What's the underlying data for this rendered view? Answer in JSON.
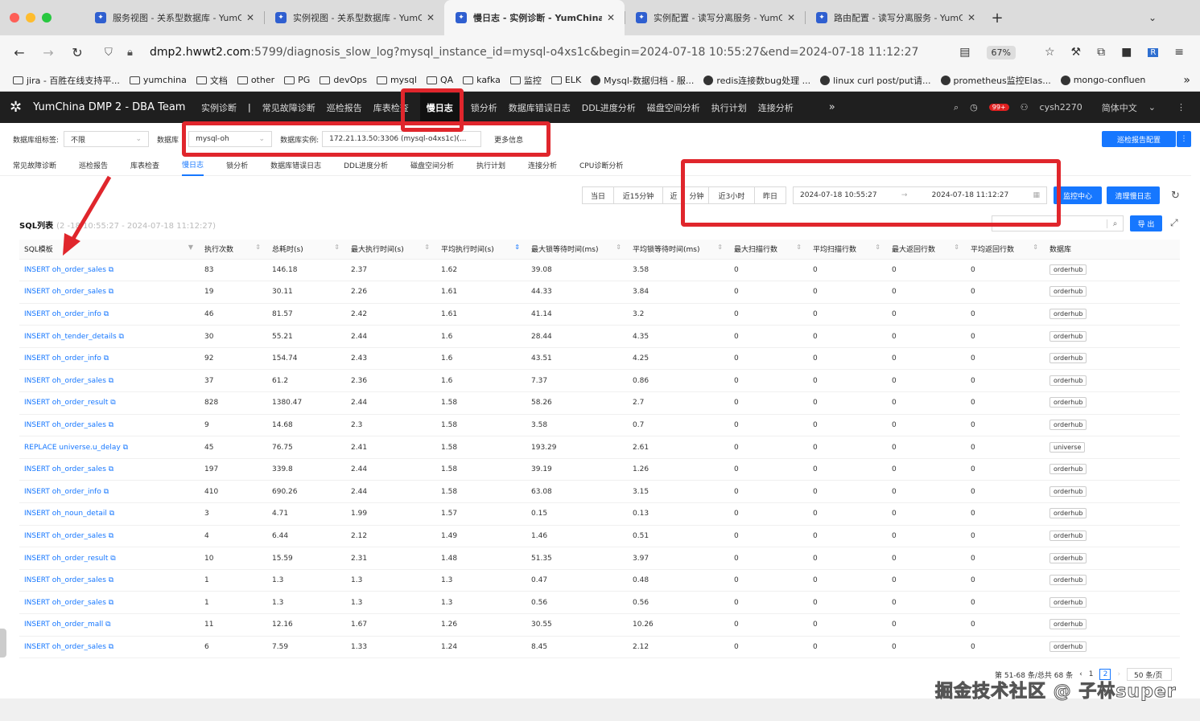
{
  "browser": {
    "tabs": [
      {
        "label": "服务视图 - 关系型数据库 - YumC",
        "active": false
      },
      {
        "label": "实例视图 - 关系型数据库 - YumC",
        "active": false
      },
      {
        "label": "慢日志 - 实例诊断 - YumChina D",
        "active": true
      },
      {
        "label": "实例配置 - 读写分离服务 - YumC",
        "active": false
      },
      {
        "label": "路由配置 - 读写分离服务 - YumC",
        "active": false
      }
    ],
    "url_host": "dmp2.hwwt2.com",
    "url_rest": ":5799/diagnosis_slow_log?mysql_instance_id=mysql-o4xs1c&begin=2024-07-18 10:55:27&end=2024-07-18 11:12:27",
    "zoom": "67%",
    "bookmarks": [
      "jira - 百胜在线支持平...",
      "yumchina",
      "文档",
      "other",
      "PG",
      "devOps",
      "mysql",
      "QA",
      "kafka",
      "监控",
      "ELK",
      "Mysql-数据归档 - 服...",
      "redis连接数bug处理 ...",
      "linux curl post/put请...",
      "prometheus监控Elas...",
      "mongo-confluen"
    ]
  },
  "app": {
    "brand": "YumChina DMP 2 - DBA Team",
    "nav": [
      "实例诊断",
      "常见故障诊断",
      "巡检报告",
      "库表检查",
      "慢日志",
      "锁分析",
      "数据库错误日志",
      "DDL进度分析",
      "磁盘空间分析",
      "执行计划",
      "连接分析"
    ],
    "nav_active": "慢日志",
    "notif_count": "99+",
    "user": "cysh2270",
    "language": "简体中文"
  },
  "filters": {
    "group_label": "数据库组标签:",
    "group_value": "不限",
    "db_label": "数据库",
    "db_value": "mysql-oh",
    "instance_label": "数据库实例:",
    "instance_value": "172.21.13.50:3306 (mysql-o4xs1c)(...",
    "more": "更多信息",
    "report_btn": "巡检报告配置"
  },
  "subtabs": [
    "常见故障诊断",
    "巡检报告",
    "库表检查",
    "慢日志",
    "锁分析",
    "数据库错误日志",
    "DDL进度分析",
    "磁盘空间分析",
    "执行计划",
    "连接分析",
    "CPU诊断分析"
  ],
  "subtab_active": "慢日志",
  "time": {
    "quick": [
      "当日",
      "近15分钟",
      "近",
      "分钟",
      "近3小时",
      "昨日"
    ],
    "start": "2024-07-18 10:55:27",
    "end": "2024-07-18 11:12:27",
    "monitor_btn": "监控中心",
    "clear_btn": "清理慢日志"
  },
  "sql_list": {
    "title": "SQL列表",
    "subtitle": "(2   -18 10:55:27 - 2024-07-18 11:12:27)",
    "export_btn": "导 出",
    "columns": [
      "SQL模板",
      "执行次数",
      "总耗时(s)",
      "最大执行时间(s)",
      "平均执行时间(s)",
      "最大锁等待时间(ms)",
      "平均锁等待时间(ms)",
      "最大扫描行数",
      "平均扫描行数",
      "最大返回行数",
      "平均返回行数",
      "数据库"
    ],
    "rows": [
      [
        "INSERT oh_order_sales",
        "83",
        "146.18",
        "2.37",
        "1.62",
        "39.08",
        "3.58",
        "0",
        "0",
        "0",
        "0",
        "orderhub"
      ],
      [
        "INSERT oh_order_sales",
        "19",
        "30.11",
        "2.26",
        "1.61",
        "44.33",
        "3.84",
        "0",
        "0",
        "0",
        "0",
        "orderhub"
      ],
      [
        "INSERT oh_order_info",
        "46",
        "81.57",
        "2.42",
        "1.61",
        "41.14",
        "3.2",
        "0",
        "0",
        "0",
        "0",
        "orderhub"
      ],
      [
        "INSERT oh_tender_details",
        "30",
        "55.21",
        "2.44",
        "1.6",
        "28.44",
        "4.35",
        "0",
        "0",
        "0",
        "0",
        "orderhub"
      ],
      [
        "INSERT oh_order_info",
        "92",
        "154.74",
        "2.43",
        "1.6",
        "43.51",
        "4.25",
        "0",
        "0",
        "0",
        "0",
        "orderhub"
      ],
      [
        "INSERT oh_order_sales",
        "37",
        "61.2",
        "2.36",
        "1.6",
        "7.37",
        "0.86",
        "0",
        "0",
        "0",
        "0",
        "orderhub"
      ],
      [
        "INSERT oh_order_result",
        "828",
        "1380.47",
        "2.44",
        "1.58",
        "58.26",
        "2.7",
        "0",
        "0",
        "0",
        "0",
        "orderhub"
      ],
      [
        "INSERT oh_order_sales",
        "9",
        "14.68",
        "2.3",
        "1.58",
        "3.58",
        "0.7",
        "0",
        "0",
        "0",
        "0",
        "orderhub"
      ],
      [
        "REPLACE universe.u_delay",
        "45",
        "76.75",
        "2.41",
        "1.58",
        "193.29",
        "2.61",
        "0",
        "0",
        "0",
        "0",
        "universe"
      ],
      [
        "INSERT oh_order_sales",
        "197",
        "339.8",
        "2.44",
        "1.58",
        "39.19",
        "1.26",
        "0",
        "0",
        "0",
        "0",
        "orderhub"
      ],
      [
        "INSERT oh_order_info",
        "410",
        "690.26",
        "2.44",
        "1.58",
        "63.08",
        "3.15",
        "0",
        "0",
        "0",
        "0",
        "orderhub"
      ],
      [
        "INSERT oh_noun_detail",
        "3",
        "4.71",
        "1.99",
        "1.57",
        "0.15",
        "0.13",
        "0",
        "0",
        "0",
        "0",
        "orderhub"
      ],
      [
        "INSERT oh_order_sales",
        "4",
        "6.44",
        "2.12",
        "1.49",
        "1.46",
        "0.51",
        "0",
        "0",
        "0",
        "0",
        "orderhub"
      ],
      [
        "INSERT oh_order_result",
        "10",
        "15.59",
        "2.31",
        "1.48",
        "51.35",
        "3.97",
        "0",
        "0",
        "0",
        "0",
        "orderhub"
      ],
      [
        "INSERT oh_order_sales",
        "1",
        "1.3",
        "1.3",
        "1.3",
        "0.47",
        "0.48",
        "0",
        "0",
        "0",
        "0",
        "orderhub"
      ],
      [
        "INSERT oh_order_sales",
        "1",
        "1.3",
        "1.3",
        "1.3",
        "0.56",
        "0.56",
        "0",
        "0",
        "0",
        "0",
        "orderhub"
      ],
      [
        "INSERT oh_order_mall",
        "11",
        "12.16",
        "1.67",
        "1.26",
        "30.55",
        "10.26",
        "0",
        "0",
        "0",
        "0",
        "orderhub"
      ],
      [
        "INSERT oh_order_sales",
        "6",
        "7.59",
        "1.33",
        "1.24",
        "8.45",
        "2.12",
        "0",
        "0",
        "0",
        "0",
        "orderhub"
      ]
    ]
  },
  "pagination": {
    "summary": "第 51-68 条/总共 68 条",
    "page1": "1",
    "page2": "2",
    "page_size": "50 条/页"
  },
  "watermark": "掘金技术社区 @ 子林super",
  "colors": {
    "accent": "#1677ff",
    "highlight": "#e0262c",
    "nav_bg": "#1f1f1f"
  }
}
